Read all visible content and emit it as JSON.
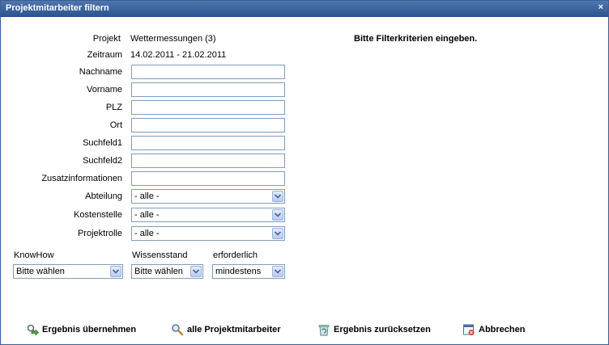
{
  "window": {
    "title": "Projektmitarbeiter filtern",
    "close": "×"
  },
  "hint": "Bitte Filterkriterien eingeben.",
  "info": {
    "projekt_label": "Projekt",
    "projekt_value": "Wettermessungen (3)",
    "zeitraum_label": "Zeitraum",
    "zeitraum_value": "14.02.2011 - 21.02.2011"
  },
  "fields": {
    "nachname": {
      "label": "Nachname",
      "value": ""
    },
    "vorname": {
      "label": "Vorname",
      "value": ""
    },
    "plz": {
      "label": "PLZ",
      "value": ""
    },
    "ort": {
      "label": "Ort",
      "value": ""
    },
    "suchfeld1": {
      "label": "Suchfeld1",
      "value": ""
    },
    "suchfeld2": {
      "label": "Suchfeld2",
      "value": ""
    },
    "zusatz": {
      "label": "Zusatzinformationen",
      "value": ""
    }
  },
  "selects": {
    "abteilung": {
      "label": "Abteilung",
      "value": "- alle -"
    },
    "kostenstelle": {
      "label": "Kostenstelle",
      "value": "- alle -"
    },
    "projektrolle": {
      "label": "Projektrolle",
      "value": "- alle -"
    }
  },
  "knowhow": {
    "knowhow_label": "KnowHow",
    "knowhow_value": "Bitte wählen",
    "wissen_label": "Wissensstand",
    "wissen_value": "Bitte wählen",
    "erforderlich_label": "erforderlich",
    "erforderlich_value": "mindestens"
  },
  "actions": {
    "apply": "Ergebnis übernehmen",
    "all": "alle Projektmitarbeiter",
    "reset": "Ergebnis zurücksetzen",
    "cancel": "Abbrechen"
  },
  "icons": {
    "apply": "apply-result-icon",
    "all": "magnifier-icon",
    "reset": "recycle-bin-icon",
    "cancel": "cancel-window-icon"
  }
}
